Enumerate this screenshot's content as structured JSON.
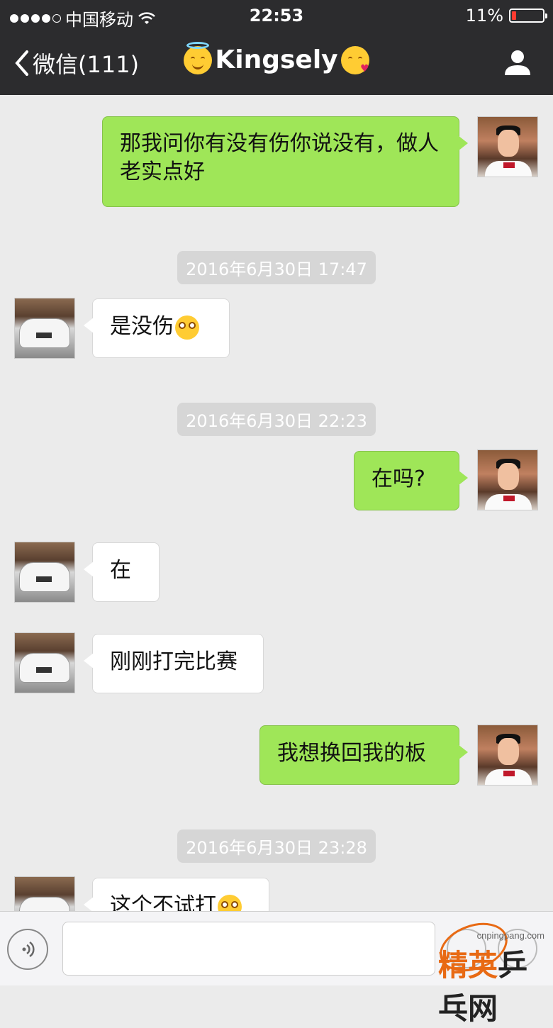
{
  "status_bar": {
    "carrier": "中国移动",
    "time": "22:53",
    "battery": "11%"
  },
  "nav": {
    "back_label": "微信(111)",
    "contact_name": "Kingsely",
    "icons": [
      "chevron-left-icon",
      "halo-smile-emoji",
      "kiss-emoji",
      "person-icon"
    ]
  },
  "messages": [
    {
      "from": "me",
      "text": "那我问你有没有伤你说没有，做人老实点好"
    },
    {
      "timestamp": "2016年6月30日 17:47"
    },
    {
      "from": "them",
      "text": "是没伤",
      "emoji": "flushed-emoji"
    },
    {
      "timestamp": "2016年6月30日 22:23"
    },
    {
      "from": "me",
      "text": "在吗?"
    },
    {
      "from": "them",
      "text": "在"
    },
    {
      "from": "them",
      "text": "刚刚打完比赛"
    },
    {
      "from": "me",
      "text": "我想换回我的板"
    },
    {
      "timestamp": "2016年6月30日 23:28"
    },
    {
      "from": "them",
      "text": "这个不试打",
      "emoji": "flushed-emoji"
    }
  ],
  "input_bar": {
    "value": "",
    "icons": [
      "voice-icon",
      "emoji-icon",
      "plus-icon"
    ]
  },
  "watermark": {
    "url": "cnpingpang.com",
    "text_a": "精英",
    "text_b": "乒乓网"
  }
}
